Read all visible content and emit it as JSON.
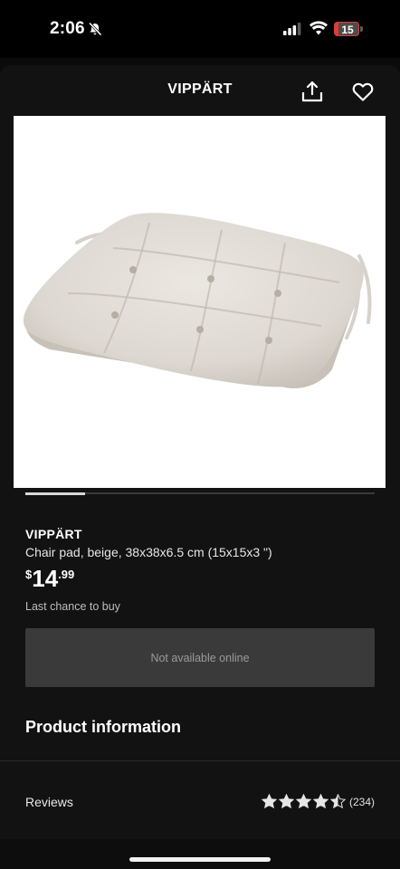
{
  "status_bar": {
    "time": "2:06",
    "battery_level": "15",
    "battery_fraction": 0.15,
    "icons": [
      "bell-off-icon",
      "signal-icon",
      "wifi-icon",
      "battery-icon"
    ],
    "battery_color": "#e23a3a"
  },
  "nav": {
    "title": "VIPPÄRT",
    "icons": [
      "share-icon",
      "heart-icon"
    ]
  },
  "carousel": {
    "progress_fraction": 0.17
  },
  "product": {
    "name": "VIPPÄRT",
    "description": "Chair pad, beige, 38x38x6.5 cm (15x15x3 \")",
    "price_currency": "$",
    "price_integer": "14",
    "price_decimal": ".99",
    "notice": "Last chance to buy",
    "availability": "Not available online"
  },
  "sections": {
    "product_information": "Product information",
    "reviews_label": "Reviews",
    "review_count": "(234)",
    "rating": 4.5
  },
  "colors": {
    "background": "#121212",
    "availability_bg": "#3a3a3a",
    "star": "#e6e6e6"
  }
}
